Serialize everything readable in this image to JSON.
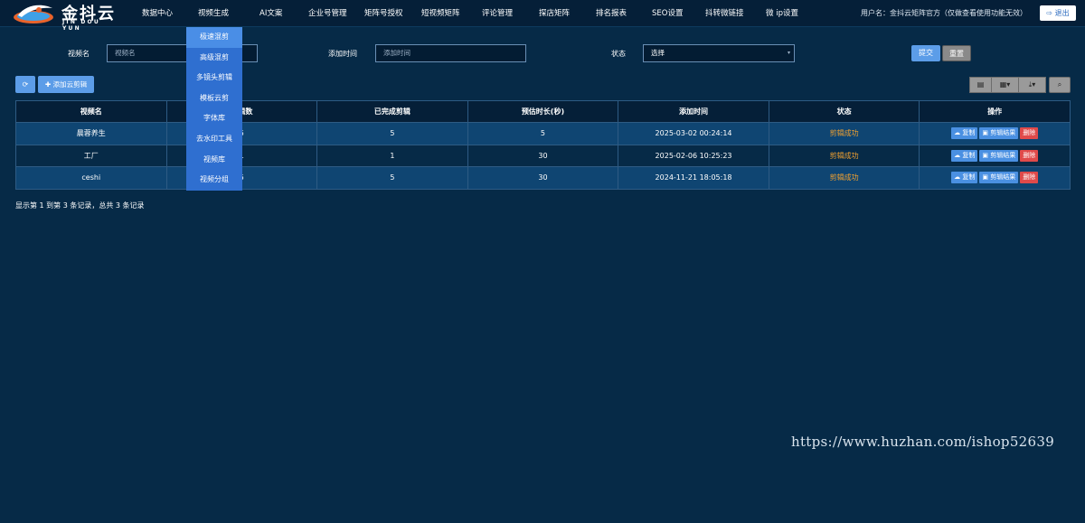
{
  "brand": {
    "name_cn": "金抖云",
    "name_en": "JIN DOU YUN"
  },
  "nav": [
    "数据中心",
    "视频生成",
    "AI文案",
    "企业号管理",
    "矩阵号授权",
    "短视频矩阵",
    "评论管理",
    "探店矩阵",
    "排名报表",
    "SEO设置",
    "抖转微链接",
    "微 ip设置"
  ],
  "user": {
    "info": "用户名：金抖云矩阵官方（仅做查看使用功能无效）",
    "logout": "退出"
  },
  "dropdown": {
    "items": [
      "极速混剪",
      "高级混剪",
      "多镜头剪辑",
      "模板云剪",
      "字体库",
      "去水印工具",
      "视频库",
      "视频分组"
    ],
    "active_index": 0
  },
  "filters": {
    "video_name_label": "视频名",
    "video_name_placeholder": "视频名",
    "add_time_label": "添加时间",
    "add_time_placeholder": "添加时间",
    "status_label": "状态",
    "status_value": "选择",
    "submit": "提交",
    "reset": "重置"
  },
  "toolbar": {
    "add_label": "添加云剪辑"
  },
  "table": {
    "headers": [
      "视频名",
      "剪辑数",
      "已完成剪辑",
      "预估时长(秒)",
      "添加时间",
      "状态",
      "操作"
    ],
    "rows": [
      {
        "name": "晨蓉养生",
        "clips": "5",
        "done": "5",
        "duration": "5",
        "time": "2025-03-02 00:24:14",
        "status": "剪辑成功"
      },
      {
        "name": "工厂",
        "clips": "1",
        "done": "1",
        "duration": "30",
        "time": "2025-02-06 10:25:23",
        "status": "剪辑成功"
      },
      {
        "name": "ceshi",
        "clips": "5",
        "done": "5",
        "duration": "30",
        "time": "2024-11-21 18:05:18",
        "status": "剪辑成功"
      }
    ],
    "actions": {
      "copy": "复制",
      "result": "剪辑结果",
      "delete": "删除"
    }
  },
  "pager": "显示第 1 到第 3 条记录，总共 3 条记录",
  "watermark": "https://www.huzhan.com/ishop52639",
  "colors": {
    "background": "#062a47",
    "accent": "#5c9de8",
    "success": "#f0a030",
    "danger": "#e04a4a"
  }
}
